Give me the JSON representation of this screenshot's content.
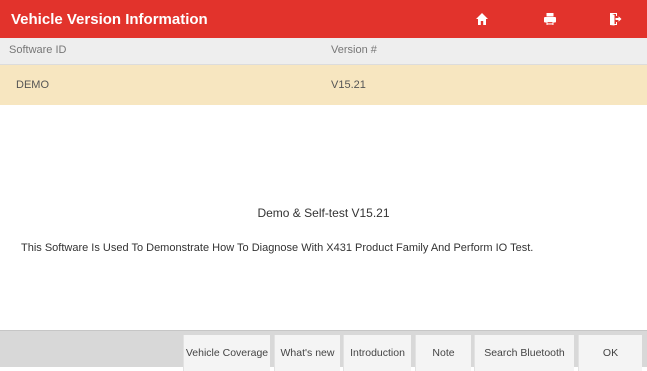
{
  "window": {
    "title": "Vehicle Version Information"
  },
  "toolbar": {
    "icons": [
      "home-icon",
      "print-icon",
      "exit-icon"
    ]
  },
  "table": {
    "columns": [
      "Software ID",
      "Version #"
    ],
    "rows": [
      {
        "software_id": "DEMO",
        "version": "V15.21"
      }
    ]
  },
  "info": {
    "title": "Demo & Self-test V15.21",
    "description": "This Software Is Used To Demonstrate How To Diagnose With X431 Product Family And Perform IO Test."
  },
  "bottom_buttons": [
    "Vehicle Coverage",
    "What's new",
    "Introduction",
    "Note",
    "Search Bluetooth",
    "OK"
  ],
  "colors": {
    "accent": "#e2332c",
    "row_highlight": "#f7e6c0"
  }
}
